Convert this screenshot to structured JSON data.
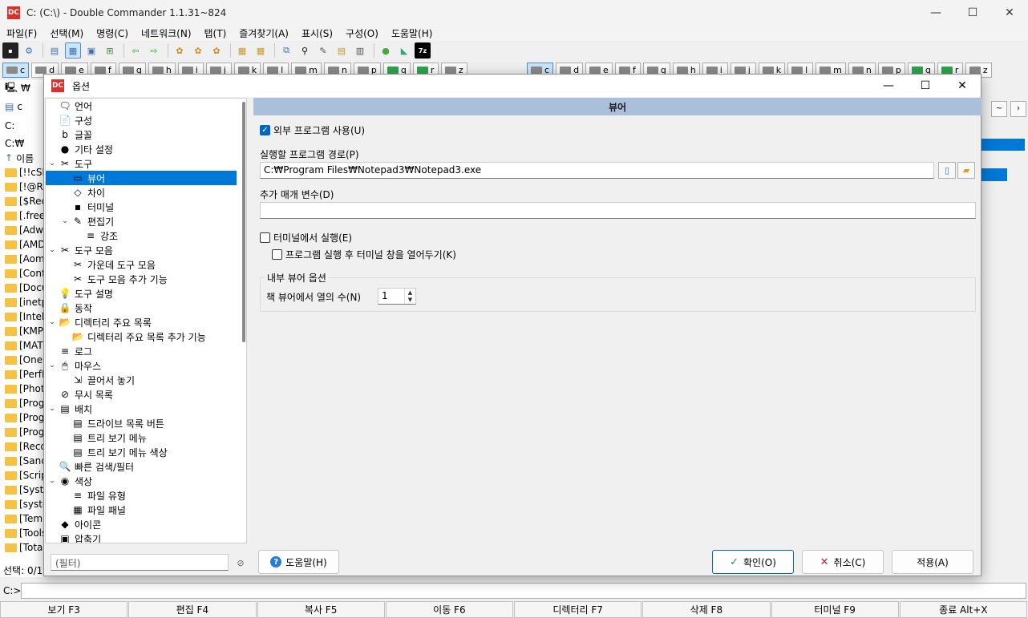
{
  "window": {
    "title": "C: (C:\\) - Double Commander 1.1.31~824",
    "logo": "DC",
    "controls": [
      "—",
      "☐",
      "✕"
    ]
  },
  "menubar": [
    "파일(F)",
    "선택(M)",
    "명령(C)",
    "네트워크(N)",
    "탭(T)",
    "즐겨찾기(A)",
    "표시(S)",
    "구성(O)",
    "도움말(H)"
  ],
  "drivebar_left": [
    "c",
    "d",
    "e",
    "f",
    "g",
    "h",
    "i",
    "j",
    "k",
    "l",
    "m",
    "n",
    "p",
    "q",
    "r",
    "z"
  ],
  "drivebar_right": [
    "c",
    "d",
    "e",
    "f",
    "g",
    "h",
    "i",
    "j",
    "k",
    "l",
    "m",
    "n",
    "p",
    "q",
    "r",
    "z"
  ],
  "left_panel": {
    "tab": "c",
    "root_tab": "₩",
    "path_combo": "C:",
    "path": "C:₩",
    "column_header": "이름",
    "entries": [
      "[!!cSk",
      "[!@Rl",
      "[$Rec",
      "[.free",
      "[Adw",
      "[AMD",
      "[Aom",
      "[Conf",
      "[Docu",
      "[inetp",
      "[Intel",
      "[KMP",
      "[MAT",
      "[OneI",
      "[PerfL",
      "[Phot",
      "[Prog",
      "[Prog",
      "[Prog",
      "[Reco",
      "[Sanc",
      "[Scrip",
      "[Syste",
      "[syste",
      "[Temp",
      "[Tools",
      "[Total"
    ],
    "status": "선택: 0/1"
  },
  "cmdline": {
    "label": "C:>"
  },
  "fkeys": [
    "보기 F3",
    "편집 F4",
    "복사 F5",
    "이동 F6",
    "디렉터리 F7",
    "삭제 F8",
    "터미널 F9",
    "종료 Alt+X"
  ],
  "dialog": {
    "title": "옵션",
    "tree": [
      {
        "label": "언어",
        "level": 0,
        "icon": "language-icon",
        "glyph": "🗨"
      },
      {
        "label": "구성",
        "level": 0,
        "icon": "config-icon",
        "glyph": "📄"
      },
      {
        "label": "글꼴",
        "level": 0,
        "icon": "font-icon",
        "glyph": "b"
      },
      {
        "label": "기타 설정",
        "level": 0,
        "icon": "misc-icon",
        "glyph": "●"
      },
      {
        "label": "도구",
        "level": 0,
        "icon": "tools-icon",
        "glyph": "✂",
        "expanded": true
      },
      {
        "label": "뷰어",
        "level": 1,
        "icon": "viewer-icon",
        "glyph": "▭",
        "selected": true
      },
      {
        "label": "차이",
        "level": 1,
        "icon": "diff-icon",
        "glyph": "◇"
      },
      {
        "label": "터미널",
        "level": 1,
        "icon": "terminal-icon",
        "glyph": "▪"
      },
      {
        "label": "편집기",
        "level": 1,
        "icon": "editor-icon",
        "glyph": "✎",
        "expanded": true
      },
      {
        "label": "강조",
        "level": 2,
        "icon": "highlight-icon",
        "glyph": "≡"
      },
      {
        "label": "도구 모음",
        "level": 0,
        "icon": "toolbar-icon",
        "glyph": "✂",
        "expanded": true
      },
      {
        "label": "가운데 도구 모음",
        "level": 1,
        "icon": "middle-toolbar-icon",
        "glyph": "✂"
      },
      {
        "label": "도구 모음 추가 기능",
        "level": 1,
        "icon": "toolbar-extra-icon",
        "glyph": "✂"
      },
      {
        "label": "도구 설명",
        "level": 0,
        "icon": "tooltip-icon",
        "glyph": "💡"
      },
      {
        "label": "동작",
        "level": 0,
        "icon": "behavior-icon",
        "glyph": "🔒"
      },
      {
        "label": "디렉터리 주요 목록",
        "level": 0,
        "icon": "hotlist-icon",
        "glyph": "📂",
        "expanded": true
      },
      {
        "label": "디렉터리 주요 목록 추가 기능",
        "level": 1,
        "icon": "hotlist-extra-icon",
        "glyph": "📂"
      },
      {
        "label": "로그",
        "level": 0,
        "icon": "log-icon",
        "glyph": "≡"
      },
      {
        "label": "마우스",
        "level": 0,
        "icon": "mouse-icon",
        "glyph": "🖱",
        "expanded": true
      },
      {
        "label": "끌어서 놓기",
        "level": 1,
        "icon": "drag-drop-icon",
        "glyph": "⇲"
      },
      {
        "label": "무시 목록",
        "level": 0,
        "icon": "ignore-list-icon",
        "glyph": "⊘"
      },
      {
        "label": "배치",
        "level": 0,
        "icon": "layout-icon",
        "glyph": "▤",
        "expanded": true
      },
      {
        "label": "드라이브 목록 버튼",
        "level": 1,
        "icon": "drive-list-icon",
        "glyph": "▤"
      },
      {
        "label": "트리 보기 메뉴",
        "level": 1,
        "icon": "tree-menu-icon",
        "glyph": "▤"
      },
      {
        "label": "트리 보기 메뉴 색상",
        "level": 1,
        "icon": "tree-menu-color-icon",
        "glyph": "▤"
      },
      {
        "label": "빠른 검색/필터",
        "level": 0,
        "icon": "quick-search-icon",
        "glyph": "🔍"
      },
      {
        "label": "색상",
        "level": 0,
        "icon": "colors-icon",
        "glyph": "◉",
        "expanded": true
      },
      {
        "label": "파일 유형",
        "level": 1,
        "icon": "file-types-icon",
        "glyph": "≡"
      },
      {
        "label": "파일 패널",
        "level": 1,
        "icon": "file-panels-icon",
        "glyph": "▦"
      },
      {
        "label": "아이콘",
        "level": 0,
        "icon": "icons-icon",
        "glyph": "◆"
      },
      {
        "label": "압축기",
        "level": 0,
        "icon": "archiver-icon",
        "glyph": "▣"
      }
    ],
    "content": {
      "header": "뷰어",
      "use_external": {
        "label": "외부 프로그램 사용(U)",
        "checked": true
      },
      "path_label": "실행할 프로그램 경로(P)",
      "path_value": "C:₩Program Files₩Notepad3₩Notepad3.exe",
      "params_label": "추가 매개 변수(D)",
      "params_value": "",
      "run_in_terminal": {
        "label": "터미널에서 실행(E)",
        "checked": false
      },
      "keep_terminal": {
        "label": "프로그램 실행 후 터미널 창을 열어두기(K)",
        "checked": false
      },
      "group_title": "내부 뷰어 옵션",
      "columns_label": "책 뷰어에서 열의 수(N)",
      "columns_value": "1"
    },
    "bottom": {
      "filter_placeholder": "(필터)",
      "help": "도움말(H)",
      "ok": "확인(O)",
      "cancel": "취소(C)",
      "apply": "적용(A)"
    }
  }
}
